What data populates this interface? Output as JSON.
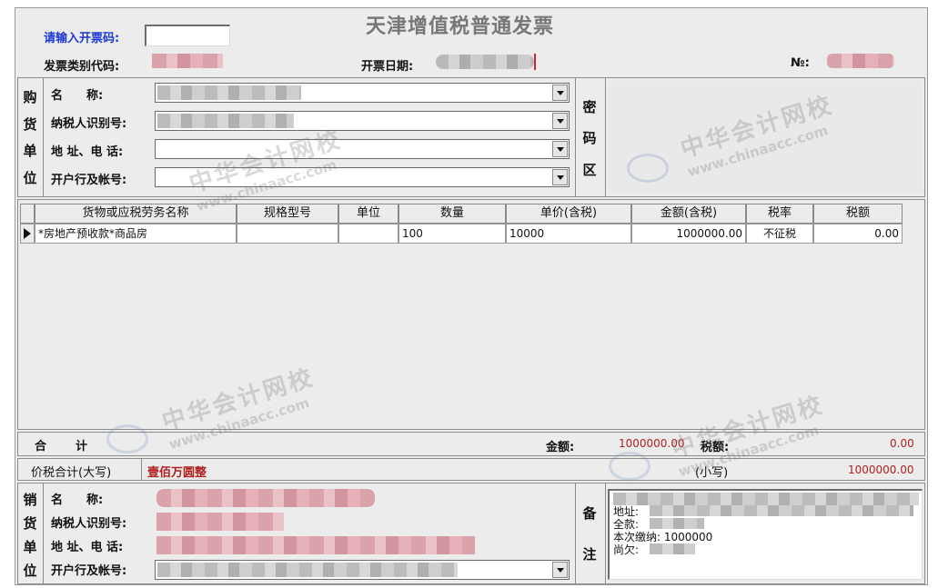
{
  "header": {
    "title": "天津增值税普通发票",
    "code_prompt": "请输入开票码:",
    "code_value": "",
    "type_code_label": "发票类别代码:",
    "date_label": "开票日期:",
    "no_label": "№:"
  },
  "buyer": {
    "side_title": [
      "购",
      "货",
      "单",
      "位"
    ],
    "name_label": "名　　称:",
    "tax_id_label": "纳税人识别号:",
    "address_label": "地 址、电 话:",
    "bank_label": "开户行及帐号:"
  },
  "cipher": {
    "side_title": [
      "密",
      "码",
      "区"
    ]
  },
  "table": {
    "headers": [
      "货物或应税劳务名称",
      "规格型号",
      "单位",
      "数量",
      "单价(含税)",
      "金额(含税)",
      "税率",
      "税额"
    ],
    "rows": [
      {
        "name": "*房地产预收款*商品房",
        "spec": "",
        "unit": "",
        "quantity": "100",
        "unit_price": "10000",
        "amount": "1000000.00",
        "tax_rate": "不征税",
        "tax": "0.00"
      }
    ]
  },
  "totals": {
    "sum_label": "合　　计",
    "amount_label": "金额:",
    "amount_value": "1000000.00",
    "tax_label": "税额:",
    "tax_value": "0.00",
    "capital_label": "价税合计(大写)",
    "capital_value": "壹佰万圆整",
    "small_label": "(小写)",
    "small_value": "1000000.00"
  },
  "seller": {
    "side_title": [
      "销",
      "货",
      "单",
      "位"
    ],
    "name_label": "名　　称:",
    "tax_id_label": "纳税人识别号:",
    "address_label": "地 址、电 话:",
    "bank_label": "开户行及帐号:"
  },
  "remarks": {
    "side_title": [
      "备",
      "注"
    ],
    "address_label": "地址:",
    "total_label": "全款:",
    "paid_line": "本次缴纳: 1000000",
    "owed_label": "尚欠:"
  },
  "watermark": {
    "cn": "中华会计网校",
    "en": "www.chinaacc.com"
  },
  "colors": {
    "prompt_blue": "#1b39d4",
    "amount_red": "#b21e1e",
    "window_bg": "#ececec"
  }
}
